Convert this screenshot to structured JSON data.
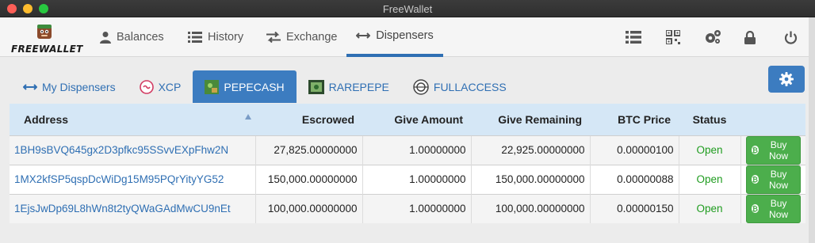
{
  "window": {
    "title": "FreeWallet"
  },
  "logo": {
    "text": "FREEWALLET"
  },
  "nav": {
    "balances": "Balances",
    "history": "History",
    "exchange": "Exchange",
    "dispensers": "Dispensers"
  },
  "tabs": {
    "my_dispensers": "My Dispensers",
    "xcp": "XCP",
    "pepecash": "PEPECASH",
    "rarepepe": "RAREPEPE",
    "fullaccess": "FULLACCESS"
  },
  "table": {
    "headers": {
      "address": "Address",
      "escrowed": "Escrowed",
      "give_amount": "Give Amount",
      "give_remaining": "Give Remaining",
      "btc_price": "BTC Price",
      "status": "Status"
    },
    "buy_label": "Buy Now",
    "rows": [
      {
        "address": "1BH9sBVQ645gx2D3pfkc95SSvvEXpFhw2N",
        "escrowed": "27,825.00000000",
        "give_amount": "1.00000000",
        "give_remaining": "22,925.00000000",
        "btc_price": "0.00000100",
        "status": "Open"
      },
      {
        "address": "1MX2kfSP5qspDcWiDg15M95PQrYityYG52",
        "escrowed": "150,000.00000000",
        "give_amount": "1.00000000",
        "give_remaining": "150,000.00000000",
        "btc_price": "0.00000088",
        "status": "Open"
      },
      {
        "address": "1EjsJwDp69L8hWn8t2tyQWaGAdMwCU9nEt",
        "escrowed": "100,000.00000000",
        "give_amount": "1.00000000",
        "give_remaining": "100,000.00000000",
        "btc_price": "0.00000150",
        "status": "Open"
      }
    ]
  },
  "colors": {
    "accent": "#3c7cc0",
    "link": "#2f6fb3",
    "open": "#1f9c1f",
    "buy": "#4cae4c",
    "header_bg": "#d5e7f6"
  }
}
